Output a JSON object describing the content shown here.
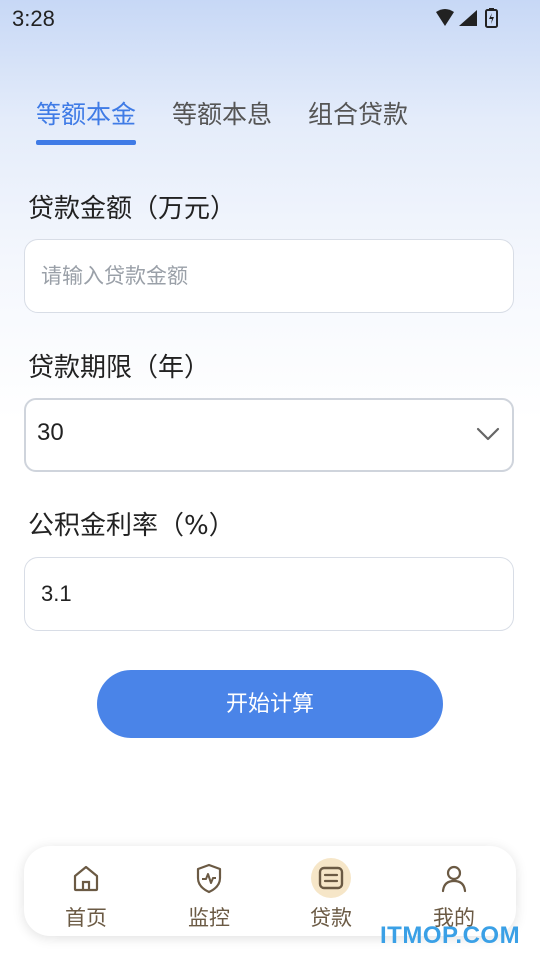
{
  "status_bar": {
    "time": "3:28"
  },
  "tabs": [
    {
      "label": "等额本金",
      "active": true
    },
    {
      "label": "等额本息",
      "active": false
    },
    {
      "label": "组合贷款",
      "active": false
    }
  ],
  "form": {
    "loan_amount": {
      "label": "贷款金额（万元）",
      "placeholder": "请输入贷款金额",
      "value": ""
    },
    "loan_term": {
      "label": "贷款期限（年）",
      "value": "30"
    },
    "rate": {
      "label": "公积金利率（%）",
      "value": "3.1"
    }
  },
  "actions": {
    "calculate_label": "开始计算"
  },
  "bottom_nav": [
    {
      "label": "首页",
      "icon": "home-icon"
    },
    {
      "label": "监控",
      "icon": "shield-icon"
    },
    {
      "label": "贷款",
      "icon": "loan-icon",
      "active": true
    },
    {
      "label": "我的",
      "icon": "user-icon"
    }
  ],
  "watermark": "ITMOP.COM",
  "colors": {
    "accent": "#3f7be6",
    "button": "#4a84e8",
    "nav_text": "#6b5a44",
    "nav_active_bg": "#f6e6c8"
  }
}
